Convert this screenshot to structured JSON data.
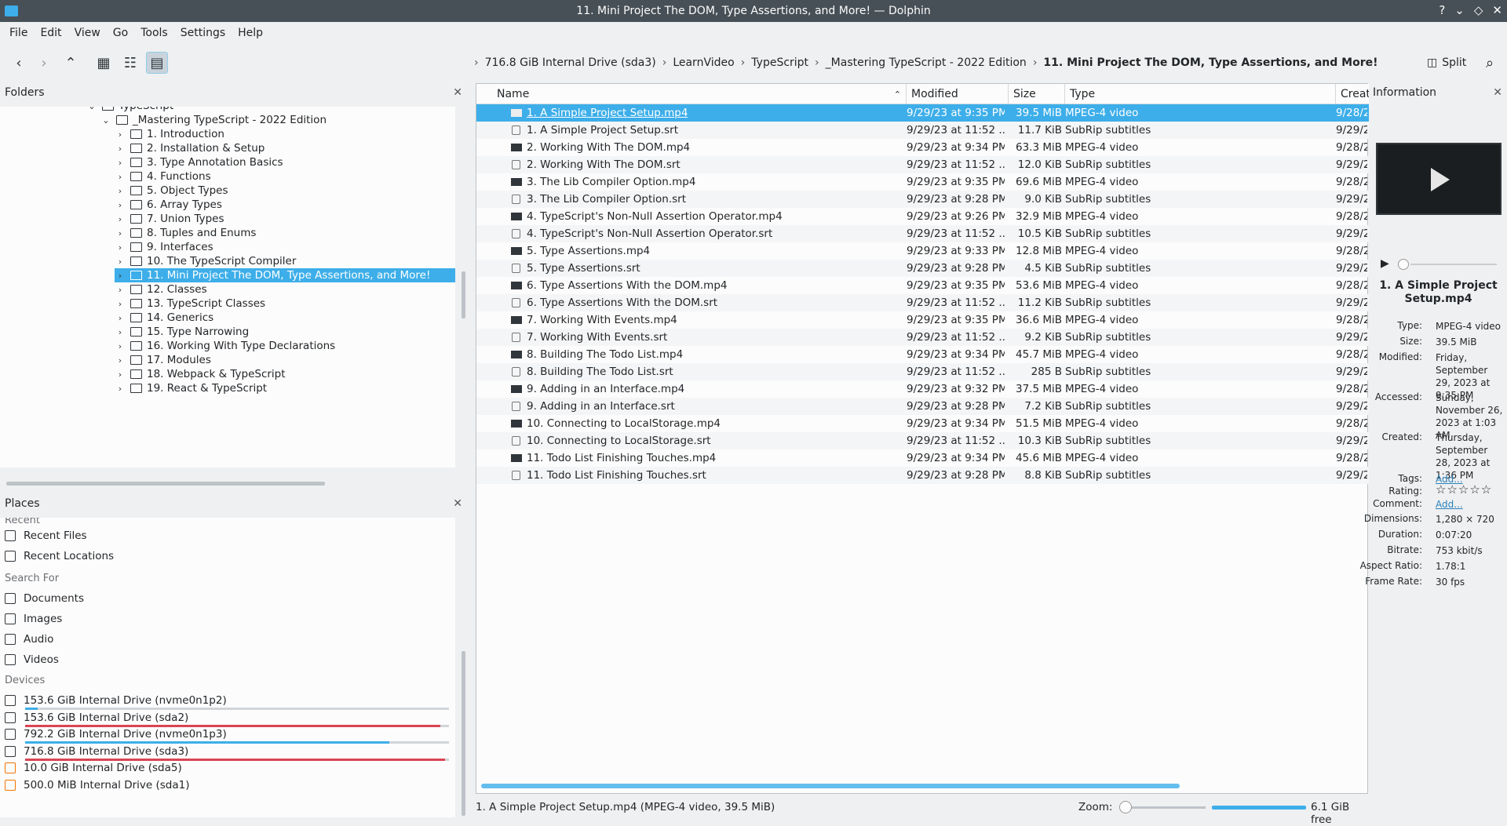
{
  "window": {
    "title": "11. Mini Project The DOM, Type Assertions, and More! — Dolphin",
    "controls": [
      "?",
      "⌄",
      "◇",
      "✕"
    ]
  },
  "menu": [
    "File",
    "Edit",
    "View",
    "Go",
    "Tools",
    "Settings",
    "Help"
  ],
  "toolbar": {
    "breadcrumb": [
      "716.8 GiB Internal Drive (sda3)",
      "LearnVideo",
      "TypeScript",
      "_Mastering TypeScript - 2022 Edition",
      "11. Mini Project The DOM, Type Assertions, and More!"
    ],
    "split_label": "Split"
  },
  "folders": {
    "title": "Folders",
    "items": [
      {
        "label": "TypeScript",
        "level": 0,
        "expanded": true
      },
      {
        "label": "_Mastering TypeScript - 2022 Edition",
        "level": 1,
        "expanded": true
      },
      {
        "label": "1. Introduction",
        "level": 2
      },
      {
        "label": "2. Installation & Setup",
        "level": 2
      },
      {
        "label": "3. Type Annotation Basics",
        "level": 2
      },
      {
        "label": "4. Functions",
        "level": 2
      },
      {
        "label": "5. Object Types",
        "level": 2
      },
      {
        "label": "6. Array Types",
        "level": 2
      },
      {
        "label": "7. Union Types",
        "level": 2
      },
      {
        "label": "8. Tuples and Enums",
        "level": 2
      },
      {
        "label": "9. Interfaces",
        "level": 2
      },
      {
        "label": "10. The TypeScript Compiler",
        "level": 2
      },
      {
        "label": "11. Mini Project The DOM, Type Assertions, and More!",
        "level": 2,
        "selected": true
      },
      {
        "label": "12. Classes",
        "level": 2
      },
      {
        "label": "13. TypeScript Classes",
        "level": 2
      },
      {
        "label": "14. Generics",
        "level": 2
      },
      {
        "label": "15. Type Narrowing",
        "level": 2
      },
      {
        "label": "16. Working With Type Declarations",
        "level": 2
      },
      {
        "label": "17. Modules",
        "level": 2
      },
      {
        "label": "18. Webpack & TypeScript",
        "level": 2
      },
      {
        "label": "19. React & TypeScript",
        "level": 2
      }
    ]
  },
  "places": {
    "title": "Places",
    "recent_heading": "Recent",
    "recent": [
      "Recent Files",
      "Recent Locations"
    ],
    "search_heading": "Search For",
    "search": [
      "Documents",
      "Images",
      "Audio",
      "Videos"
    ],
    "devices_heading": "Devices",
    "devices": [
      {
        "label": "153.6 GiB Internal Drive (nvme0n1p2)",
        "usage": 0.03,
        "color": "#3daee9"
      },
      {
        "label": "153.6 GiB Internal Drive (sda2)",
        "usage": 0.98,
        "color": "#da4453"
      },
      {
        "label": "792.2 GiB Internal Drive (nvme0n1p3)",
        "usage": 0.86,
        "color": "#3daee9"
      },
      {
        "label": "716.8 GiB Internal Drive (sda3)",
        "usage": 0.99,
        "color": "#da4453"
      },
      {
        "label": "10.0 GiB Internal Drive (sda5)",
        "usage": null,
        "color": "#f67400"
      },
      {
        "label": "500.0 MiB Internal Drive (sda1)",
        "usage": null,
        "color": "#f67400"
      }
    ]
  },
  "columns": {
    "name": "Name",
    "modified": "Modified",
    "size": "Size",
    "type": "Type",
    "created": "Create"
  },
  "files": [
    {
      "name": "1. A Simple Project Setup.mp4",
      "modified": "9/29/23 at 9:35 PM",
      "size": "39.5 MiB",
      "type": "MPEG-4 video",
      "created": "9/28/2",
      "kind": "video",
      "selected": true
    },
    {
      "name": "1. A Simple Project Setup.srt",
      "modified": "9/29/23 at 11:52 ...",
      "size": "11.7 KiB",
      "type": "SubRip subtitles",
      "created": "9/29/2",
      "kind": "srt"
    },
    {
      "name": "2. Working With The DOM.mp4",
      "modified": "9/29/23 at 9:34 PM",
      "size": "63.3 MiB",
      "type": "MPEG-4 video",
      "created": "9/28/2",
      "kind": "video"
    },
    {
      "name": "2. Working With The DOM.srt",
      "modified": "9/29/23 at 11:52 ...",
      "size": "12.0 KiB",
      "type": "SubRip subtitles",
      "created": "9/29/2",
      "kind": "srt"
    },
    {
      "name": "3. The Lib Compiler Option.mp4",
      "modified": "9/29/23 at 9:35 PM",
      "size": "69.6 MiB",
      "type": "MPEG-4 video",
      "created": "9/28/2",
      "kind": "video"
    },
    {
      "name": "3. The Lib Compiler Option.srt",
      "modified": "9/29/23 at 9:28 PM",
      "size": "9.0 KiB",
      "type": "SubRip subtitles",
      "created": "9/29/2",
      "kind": "srt"
    },
    {
      "name": "4. TypeScript's Non-Null Assertion Operator.mp4",
      "modified": "9/29/23 at 9:26 PM",
      "size": "32.9 MiB",
      "type": "MPEG-4 video",
      "created": "9/28/2",
      "kind": "video"
    },
    {
      "name": "4. TypeScript's Non-Null Assertion Operator.srt",
      "modified": "9/29/23 at 11:52 ...",
      "size": "10.5 KiB",
      "type": "SubRip subtitles",
      "created": "9/29/2",
      "kind": "srt"
    },
    {
      "name": "5. Type Assertions.mp4",
      "modified": "9/29/23 at 9:33 PM",
      "size": "12.8 MiB",
      "type": "MPEG-4 video",
      "created": "9/28/2",
      "kind": "video"
    },
    {
      "name": "5. Type Assertions.srt",
      "modified": "9/29/23 at 9:28 PM",
      "size": "4.5 KiB",
      "type": "SubRip subtitles",
      "created": "9/29/2",
      "kind": "srt"
    },
    {
      "name": "6. Type Assertions With the DOM.mp4",
      "modified": "9/29/23 at 9:35 PM",
      "size": "53.6 MiB",
      "type": "MPEG-4 video",
      "created": "9/28/2",
      "kind": "video"
    },
    {
      "name": "6. Type Assertions With the DOM.srt",
      "modified": "9/29/23 at 11:52 ...",
      "size": "11.2 KiB",
      "type": "SubRip subtitles",
      "created": "9/29/2",
      "kind": "srt"
    },
    {
      "name": "7. Working With Events.mp4",
      "modified": "9/29/23 at 9:35 PM",
      "size": "36.6 MiB",
      "type": "MPEG-4 video",
      "created": "9/28/2",
      "kind": "video"
    },
    {
      "name": "7. Working With Events.srt",
      "modified": "9/29/23 at 11:52 ...",
      "size": "9.2 KiB",
      "type": "SubRip subtitles",
      "created": "9/29/2",
      "kind": "srt"
    },
    {
      "name": "8. Building The Todo List.mp4",
      "modified": "9/29/23 at 9:34 PM",
      "size": "45.7 MiB",
      "type": "MPEG-4 video",
      "created": "9/28/2",
      "kind": "video"
    },
    {
      "name": "8. Building The Todo List.srt",
      "modified": "9/29/23 at 11:52 ...",
      "size": "285 B",
      "type": "SubRip subtitles",
      "created": "9/29/2",
      "kind": "srt"
    },
    {
      "name": "9. Adding in an Interface.mp4",
      "modified": "9/29/23 at 9:32 PM",
      "size": "37.5 MiB",
      "type": "MPEG-4 video",
      "created": "9/28/2",
      "kind": "video"
    },
    {
      "name": "9. Adding in an Interface.srt",
      "modified": "9/29/23 at 9:28 PM",
      "size": "7.2 KiB",
      "type": "SubRip subtitles",
      "created": "9/29/2",
      "kind": "srt"
    },
    {
      "name": "10. Connecting to LocalStorage.mp4",
      "modified": "9/29/23 at 9:34 PM",
      "size": "51.5 MiB",
      "type": "MPEG-4 video",
      "created": "9/28/2",
      "kind": "video"
    },
    {
      "name": "10. Connecting to LocalStorage.srt",
      "modified": "9/29/23 at 11:52 ...",
      "size": "10.3 KiB",
      "type": "SubRip subtitles",
      "created": "9/29/2",
      "kind": "srt"
    },
    {
      "name": "11. Todo List Finishing Touches.mp4",
      "modified": "9/29/23 at 9:34 PM",
      "size": "45.6 MiB",
      "type": "MPEG-4 video",
      "created": "9/28/2",
      "kind": "video"
    },
    {
      "name": "11. Todo List Finishing Touches.srt",
      "modified": "9/29/23 at 9:28 PM",
      "size": "8.8 KiB",
      "type": "SubRip subtitles",
      "created": "9/29/2",
      "kind": "srt"
    }
  ],
  "info": {
    "title": "Information",
    "name": "1. A Simple Project Setup.mp4",
    "fields": [
      {
        "k": "Type:",
        "v": "MPEG-4 video"
      },
      {
        "k": "Size:",
        "v": "39.5 MiB"
      },
      {
        "k": "Modified:",
        "v": "Friday, September 29, 2023 at 9:35 PM"
      },
      {
        "k": "Accessed:",
        "v": "Sunday, November 26, 2023 at 1:03 AM"
      },
      {
        "k": "Created:",
        "v": "Thursday, September 28, 2023 at 1:36 PM"
      },
      {
        "k": "Tags:",
        "v": "Add...",
        "link": true
      },
      {
        "k": "Rating:",
        "v": "☆☆☆☆☆"
      },
      {
        "k": "Comment:",
        "v": "Add...",
        "link": true
      },
      {
        "k": "Dimensions:",
        "v": "1,280 × 720"
      },
      {
        "k": "Duration:",
        "v": "0:07:20"
      },
      {
        "k": "Bitrate:",
        "v": "753 kbit/s"
      },
      {
        "k": "Aspect Ratio:",
        "v": "1.78:1"
      },
      {
        "k": "Frame Rate:",
        "v": "30 fps"
      }
    ]
  },
  "status": {
    "text": "1. A Simple Project Setup.mp4 (MPEG-4 video, 39.5 MiB)",
    "zoom_label": "Zoom:",
    "free": "6.1 GiB free"
  }
}
